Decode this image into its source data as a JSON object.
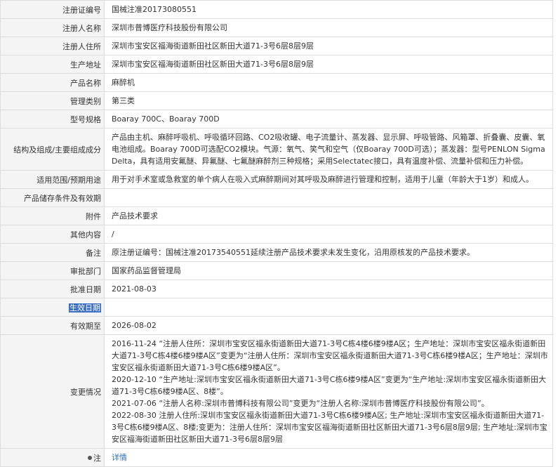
{
  "rows": {
    "reg_no": {
      "label": "注册证编号",
      "value": "国械注准20173080551"
    },
    "registrant": {
      "label": "注册人名称",
      "value": "深圳市普博医疗科技股份有限公司"
    },
    "registrant_address": {
      "label": "注册人住所",
      "value": "深圳市宝安区福海街道新田社区新田大道71-3号6层8层9层"
    },
    "production_address": {
      "label": "生产地址",
      "value": "深圳市宝安区福海街道新田社区新田大道71-3号6层8层9层"
    },
    "product_name": {
      "label": "产品名称",
      "value": "麻醉机"
    },
    "category": {
      "label": "管理类别",
      "value": "第三类"
    },
    "model": {
      "label": "型号规格",
      "value": "Boaray 700C、Boaray 700D"
    },
    "structure": {
      "label": "结构及组成/主要组成成分",
      "value": "产品由主机、麻醉呼吸机、呼吸循环回路、CO2吸收罐、电子流量计、蒸发器、显示屏、呼吸管路、风箱罩、折叠囊、皮囊、氧电池组成。Boaray 700D可选配CO2模块。气源：氧气、笑气和空气（仅Boaray 700D可选）；蒸发器：型号PENLON Sigma Delta，具有适用安氟醚、异氟醚、七氟醚麻醉剂三种规格；采用Selectatec接口，具有温度补偿、流量补偿和压力补偿。"
    },
    "scope": {
      "label": "适用范围/预期用途",
      "value": "用于对手术室或急救室的单个病人在吸入式麻醉期间对其呼吸及麻醉进行管理和控制，适用于儿童（年龄大于1岁）和成人。"
    },
    "storage": {
      "label": "产品储存条件及有效期",
      "value": ""
    },
    "attachment": {
      "label": "附件",
      "value": "产品技术要求"
    },
    "other": {
      "label": "其他内容",
      "value": "/"
    },
    "remark": {
      "label": "备注",
      "value": "原注册证编号：国械注准20173540551延续注册产品技术要求未发生变化，沿用原核发的产品技术要求。"
    },
    "approval_dept": {
      "label": "审批部门",
      "value": "国家药品监督管理局"
    },
    "approval_date": {
      "label": "批准日期",
      "value": "2021-08-03"
    },
    "effective_date": {
      "label": "生效日期",
      "value": ""
    },
    "expiry_date": {
      "label": "有效期至",
      "value": "2026-08-02"
    },
    "changes": {
      "label": "变更情况",
      "items": [
        "2016-11-24 “注册人住所：深圳市宝安区福永街道新田大道71-3号C栋4楼6楼9楼A区；生产地址：深圳市宝安区福永街道新田大道71-3号C栋4楼6楼9楼A区”变更为“注册人住所：深圳市宝安区福永街道新田大道71-3号C栋6楼9楼A区；生产地址：深圳市宝安区福永街道新田大道71-3号C栋6楼9楼A区”。",
        "2020-12-10 “生产地址:深圳市宝安区福永街道新田大道71-3号C栋6楼9楼A区”变更为“生产地址:深圳市宝安区福永街道新田大道71-3号C栋6楼9楼A区、8楼”。",
        "2021-07-06 “注册人名称:深圳市普博科技有限公司”变更为“注册人名称:深圳市普博医疗科技股份有限公司”。",
        "2022-08-30 注册人住所:深圳市宝安区福永街道新田大道71-3号C栋6楼9楼A区; 生产地址:深圳市宝安区福永街道新田大道71-3号C栋6楼9楼A区、8楼;变更为：注册人住所：深圳市宝安区福海街道新田社区新田大道71-3号6层8层9层; 生产地址:深圳市宝安区福海街道新田社区新田大道71-3号6层8层9层"
      ]
    },
    "note": {
      "label": "注",
      "value": "详情"
    }
  }
}
